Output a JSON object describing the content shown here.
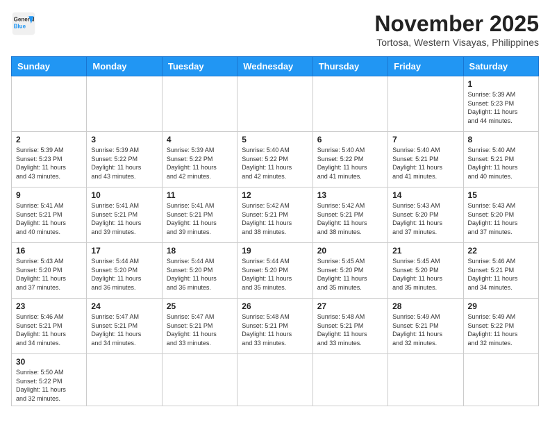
{
  "logo": {
    "line1": "General",
    "line2": "Blue"
  },
  "title": "November 2025",
  "subtitle": "Tortosa, Western Visayas, Philippines",
  "weekdays": [
    "Sunday",
    "Monday",
    "Tuesday",
    "Wednesday",
    "Thursday",
    "Friday",
    "Saturday"
  ],
  "weeks": [
    [
      {
        "day": "",
        "info": ""
      },
      {
        "day": "",
        "info": ""
      },
      {
        "day": "",
        "info": ""
      },
      {
        "day": "",
        "info": ""
      },
      {
        "day": "",
        "info": ""
      },
      {
        "day": "",
        "info": ""
      },
      {
        "day": "1",
        "info": "Sunrise: 5:39 AM\nSunset: 5:23 PM\nDaylight: 11 hours\nand 44 minutes."
      }
    ],
    [
      {
        "day": "2",
        "info": "Sunrise: 5:39 AM\nSunset: 5:23 PM\nDaylight: 11 hours\nand 43 minutes."
      },
      {
        "day": "3",
        "info": "Sunrise: 5:39 AM\nSunset: 5:22 PM\nDaylight: 11 hours\nand 43 minutes."
      },
      {
        "day": "4",
        "info": "Sunrise: 5:39 AM\nSunset: 5:22 PM\nDaylight: 11 hours\nand 42 minutes."
      },
      {
        "day": "5",
        "info": "Sunrise: 5:40 AM\nSunset: 5:22 PM\nDaylight: 11 hours\nand 42 minutes."
      },
      {
        "day": "6",
        "info": "Sunrise: 5:40 AM\nSunset: 5:22 PM\nDaylight: 11 hours\nand 41 minutes."
      },
      {
        "day": "7",
        "info": "Sunrise: 5:40 AM\nSunset: 5:21 PM\nDaylight: 11 hours\nand 41 minutes."
      },
      {
        "day": "8",
        "info": "Sunrise: 5:40 AM\nSunset: 5:21 PM\nDaylight: 11 hours\nand 40 minutes."
      }
    ],
    [
      {
        "day": "9",
        "info": "Sunrise: 5:41 AM\nSunset: 5:21 PM\nDaylight: 11 hours\nand 40 minutes."
      },
      {
        "day": "10",
        "info": "Sunrise: 5:41 AM\nSunset: 5:21 PM\nDaylight: 11 hours\nand 39 minutes."
      },
      {
        "day": "11",
        "info": "Sunrise: 5:41 AM\nSunset: 5:21 PM\nDaylight: 11 hours\nand 39 minutes."
      },
      {
        "day": "12",
        "info": "Sunrise: 5:42 AM\nSunset: 5:21 PM\nDaylight: 11 hours\nand 38 minutes."
      },
      {
        "day": "13",
        "info": "Sunrise: 5:42 AM\nSunset: 5:21 PM\nDaylight: 11 hours\nand 38 minutes."
      },
      {
        "day": "14",
        "info": "Sunrise: 5:43 AM\nSunset: 5:20 PM\nDaylight: 11 hours\nand 37 minutes."
      },
      {
        "day": "15",
        "info": "Sunrise: 5:43 AM\nSunset: 5:20 PM\nDaylight: 11 hours\nand 37 minutes."
      }
    ],
    [
      {
        "day": "16",
        "info": "Sunrise: 5:43 AM\nSunset: 5:20 PM\nDaylight: 11 hours\nand 37 minutes."
      },
      {
        "day": "17",
        "info": "Sunrise: 5:44 AM\nSunset: 5:20 PM\nDaylight: 11 hours\nand 36 minutes."
      },
      {
        "day": "18",
        "info": "Sunrise: 5:44 AM\nSunset: 5:20 PM\nDaylight: 11 hours\nand 36 minutes."
      },
      {
        "day": "19",
        "info": "Sunrise: 5:44 AM\nSunset: 5:20 PM\nDaylight: 11 hours\nand 35 minutes."
      },
      {
        "day": "20",
        "info": "Sunrise: 5:45 AM\nSunset: 5:20 PM\nDaylight: 11 hours\nand 35 minutes."
      },
      {
        "day": "21",
        "info": "Sunrise: 5:45 AM\nSunset: 5:20 PM\nDaylight: 11 hours\nand 35 minutes."
      },
      {
        "day": "22",
        "info": "Sunrise: 5:46 AM\nSunset: 5:21 PM\nDaylight: 11 hours\nand 34 minutes."
      }
    ],
    [
      {
        "day": "23",
        "info": "Sunrise: 5:46 AM\nSunset: 5:21 PM\nDaylight: 11 hours\nand 34 minutes."
      },
      {
        "day": "24",
        "info": "Sunrise: 5:47 AM\nSunset: 5:21 PM\nDaylight: 11 hours\nand 34 minutes."
      },
      {
        "day": "25",
        "info": "Sunrise: 5:47 AM\nSunset: 5:21 PM\nDaylight: 11 hours\nand 33 minutes."
      },
      {
        "day": "26",
        "info": "Sunrise: 5:48 AM\nSunset: 5:21 PM\nDaylight: 11 hours\nand 33 minutes."
      },
      {
        "day": "27",
        "info": "Sunrise: 5:48 AM\nSunset: 5:21 PM\nDaylight: 11 hours\nand 33 minutes."
      },
      {
        "day": "28",
        "info": "Sunrise: 5:49 AM\nSunset: 5:21 PM\nDaylight: 11 hours\nand 32 minutes."
      },
      {
        "day": "29",
        "info": "Sunrise: 5:49 AM\nSunset: 5:22 PM\nDaylight: 11 hours\nand 32 minutes."
      }
    ],
    [
      {
        "day": "30",
        "info": "Sunrise: 5:50 AM\nSunset: 5:22 PM\nDaylight: 11 hours\nand 32 minutes."
      },
      {
        "day": "",
        "info": ""
      },
      {
        "day": "",
        "info": ""
      },
      {
        "day": "",
        "info": ""
      },
      {
        "day": "",
        "info": ""
      },
      {
        "day": "",
        "info": ""
      },
      {
        "day": "",
        "info": ""
      }
    ]
  ]
}
